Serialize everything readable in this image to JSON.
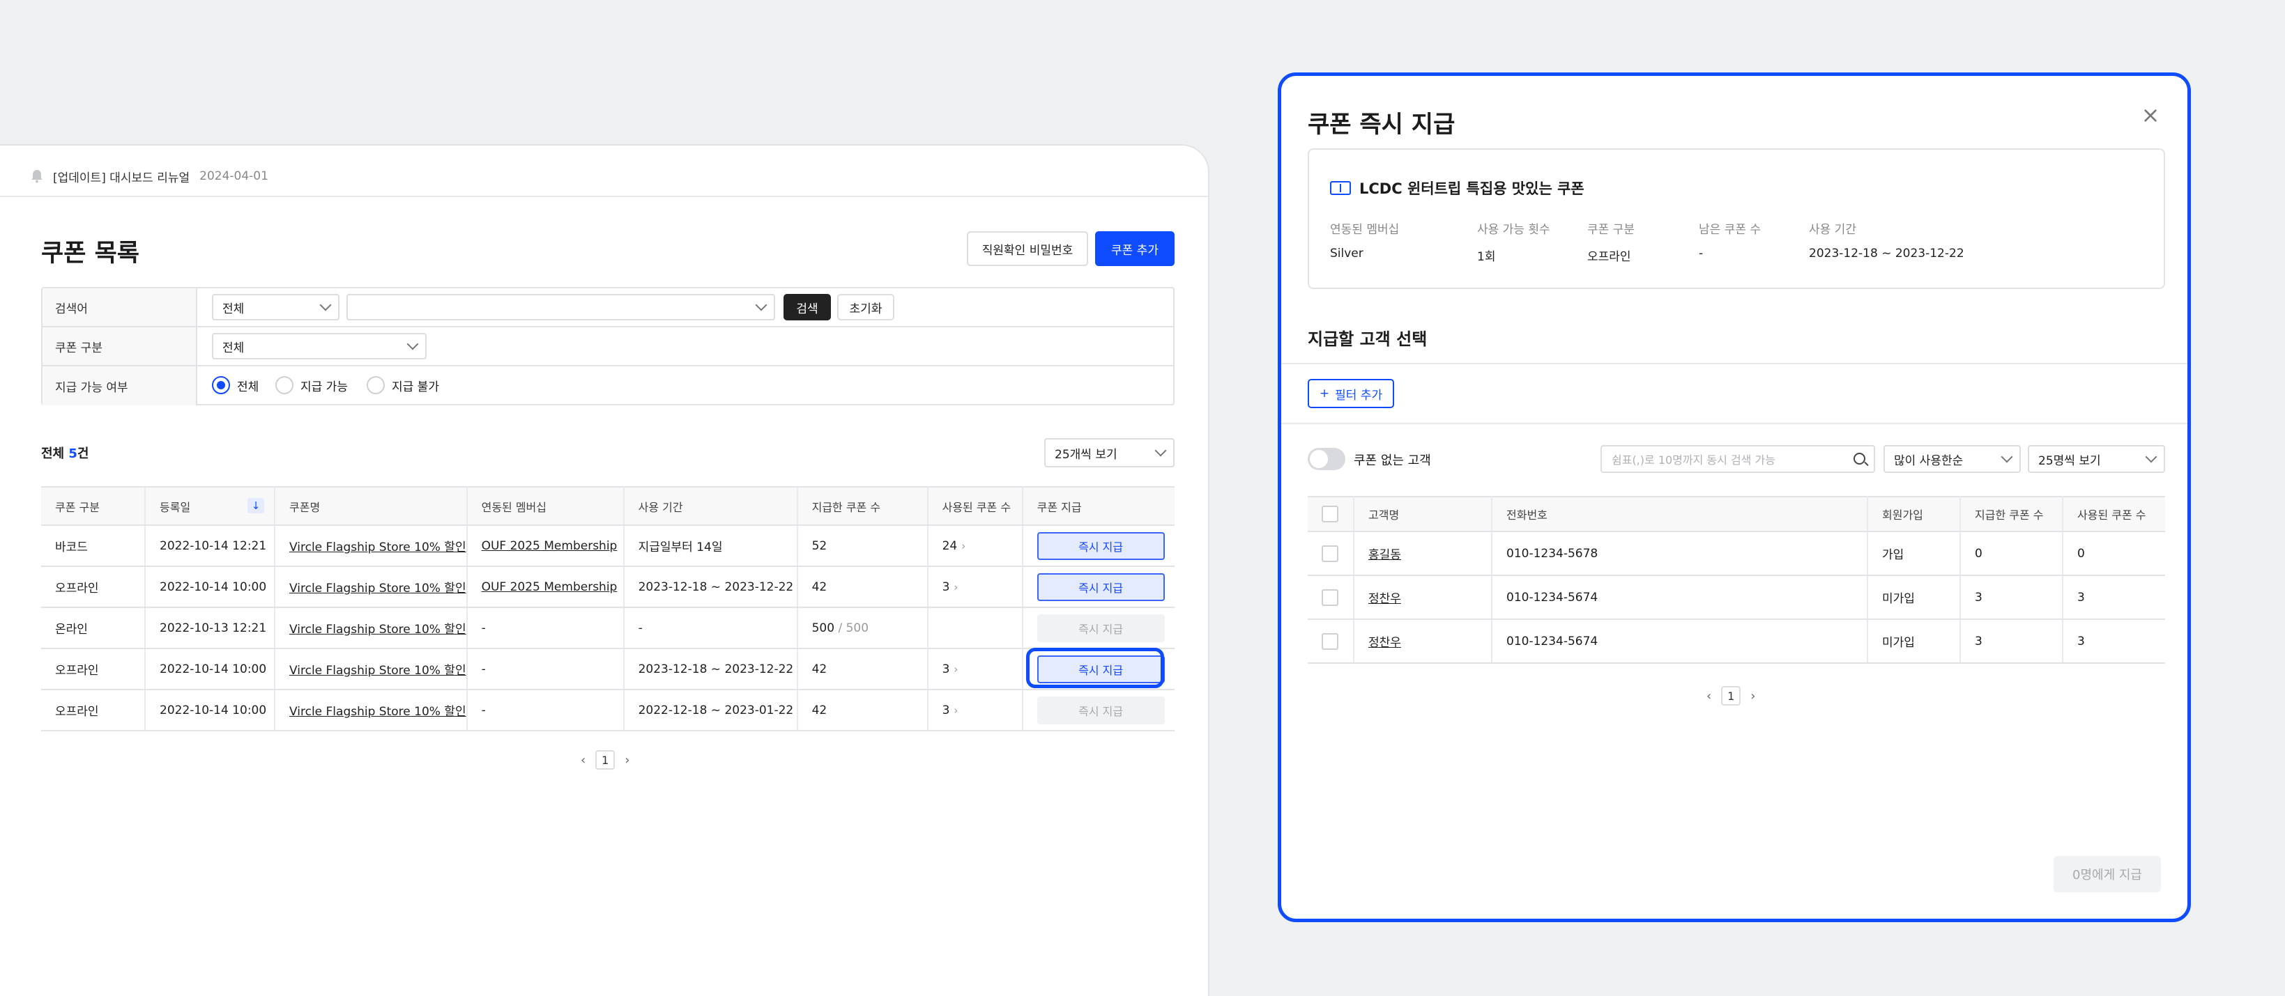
{
  "notice": {
    "text": "[업데이트] 대시보드 리뉴얼",
    "date": "2024-04-01"
  },
  "list_page": {
    "title": "쿠폰 목록",
    "staff_pw_button": "직원확인 비밀번호",
    "add_coupon_button": "쿠폰 추가",
    "filter": {
      "search_label": "검색어",
      "search_scope": "전체",
      "search_value": "",
      "search_button": "검색",
      "reset_button": "초기화",
      "type_label": "쿠폰 구분",
      "type_value": "전체",
      "availability_label": "지급 가능 여부",
      "availability_options": [
        "전체",
        "지급 가능",
        "지급 불가"
      ],
      "availability_selected": "전체"
    },
    "total_prefix": "전체 ",
    "total_count": "5",
    "total_suffix": "건",
    "page_size": "25개씩 보기",
    "columns": [
      "쿠폰 구분",
      "등록일",
      "쿠폰명",
      "연동된 멤버십",
      "사용 기간",
      "지급한 쿠폰 수",
      "사용된 쿠폰 수",
      "쿠폰 지급"
    ],
    "sort_indicator": "↓",
    "rows": [
      {
        "type": "바코드",
        "date": "2022-10-14 12:21",
        "name": "Vircle Flagship Store 10% 할인",
        "membership": "OUF 2025 Membership",
        "period": "지급일부터 14일",
        "issued": "52",
        "issued_limit": "",
        "used": "24",
        "action": "즉시 지급",
        "state": "active"
      },
      {
        "type": "오프라인",
        "date": "2022-10-14 10:00",
        "name": "Vircle Flagship Store 10% 할인",
        "membership": "OUF 2025 Membership",
        "period": "2023-12-18 ~ 2023-12-22",
        "issued": "42",
        "issued_limit": "",
        "used": "3",
        "action": "즉시 지급",
        "state": "active"
      },
      {
        "type": "온라인",
        "date": "2022-10-13 12:21",
        "name": "Vircle Flagship Store 10% 할인",
        "membership": "-",
        "period": "-",
        "issued": "500",
        "issued_limit": " / 500",
        "used": "",
        "action": "즉시 지급",
        "state": "disabled"
      },
      {
        "type": "오프라인",
        "date": "2022-10-14 10:00",
        "name": "Vircle Flagship Store 10% 할인",
        "membership": "-",
        "period": "2023-12-18 ~ 2023-12-22",
        "issued": "42",
        "issued_limit": "",
        "used": "3",
        "action": "즉시 지급",
        "state": "focused"
      },
      {
        "type": "오프라인",
        "date": "2022-10-14 10:00",
        "name": "Vircle Flagship Store 10% 할인",
        "membership": "-",
        "period": "2022-12-18 ~ 2023-01-22",
        "issued": "42",
        "issued_limit": "",
        "used": "3",
        "action": "즉시 지급",
        "state": "disabled"
      }
    ],
    "current_page": "1"
  },
  "modal": {
    "title": "쿠폰 즉시 지급",
    "coupon_name": "LCDC 윈터트립 특집용 맛있는 쿠폰",
    "meta": [
      {
        "key": "연동된 멤버십",
        "value": "Silver"
      },
      {
        "key": "사용 가능 횟수",
        "value": "1회"
      },
      {
        "key": "쿠폰 구분",
        "value": "오프라인"
      },
      {
        "key": "남은 쿠폰 수",
        "value": "-"
      },
      {
        "key": "사용 기간",
        "value": "2023-12-18 ~ 2023-12-22"
      }
    ],
    "section_title": "지급할 고객 선택",
    "add_filter_button": "필터 추가",
    "toggle_label": "쿠폰 없는 고객",
    "search_placeholder": "쉼표(,)로 10명까지 동시 검색 가능",
    "sort_value": "많이 사용한순",
    "page_size": "25명씩 보기",
    "columns": [
      "고객명",
      "전화번호",
      "회원가입",
      "지급한 쿠폰 수",
      "사용된 쿠폰 수"
    ],
    "rows": [
      {
        "name": "홍길동",
        "phone": "010-1234-5678",
        "joined": "가입",
        "issued": "0",
        "used": "0"
      },
      {
        "name": "정찬우",
        "phone": "010-1234-5674",
        "joined": "미가입",
        "issued": "3",
        "used": "3"
      },
      {
        "name": "정찬우",
        "phone": "010-1234-5674",
        "joined": "미가입",
        "issued": "3",
        "used": "3"
      }
    ],
    "current_page": "1",
    "give_button": "0명에게 지급",
    "close_glyph": "×"
  },
  "colors": {
    "accent": "#0f4bff",
    "accent_soft": "#e5ebff",
    "background": "#eff0f2"
  }
}
